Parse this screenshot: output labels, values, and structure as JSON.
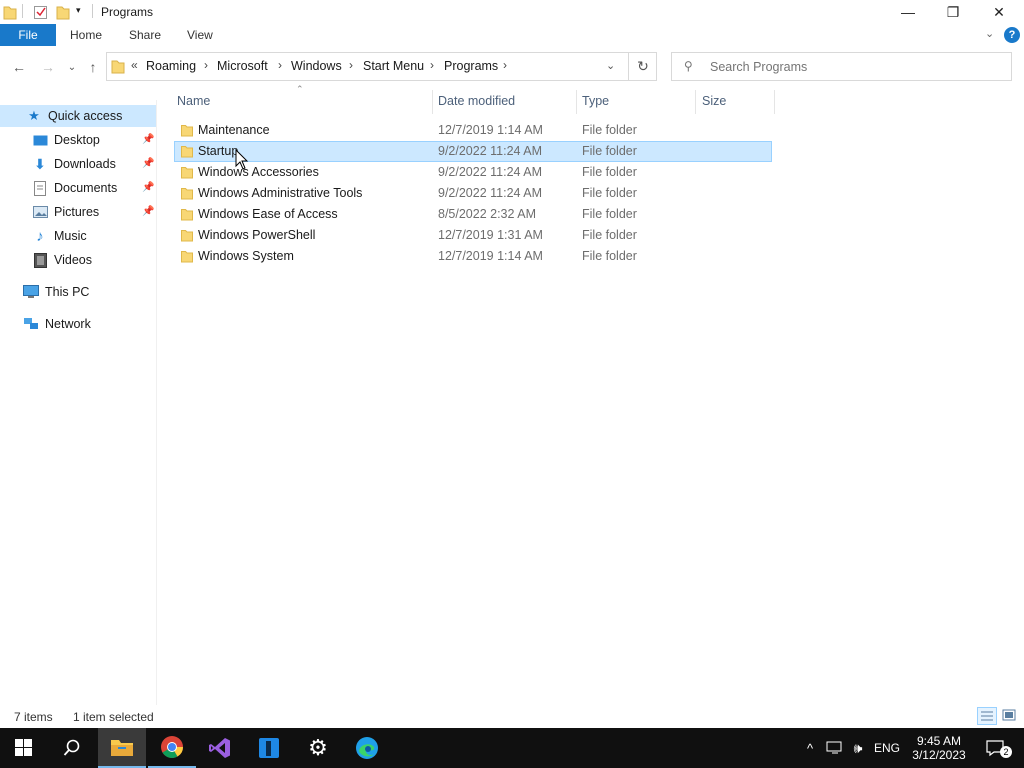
{
  "window": {
    "title": "Programs"
  },
  "ribbon": {
    "tabs": [
      "File",
      "Home",
      "Share",
      "View"
    ]
  },
  "address": {
    "overflow": "«",
    "crumbs": [
      "Roaming",
      "Microsoft",
      "Windows",
      "Start Menu",
      "Programs"
    ],
    "search_placeholder": "Search Programs"
  },
  "nav": {
    "quick_access": "Quick access",
    "items": [
      {
        "label": "Desktop",
        "icon": "desktop-icon",
        "pinned": true
      },
      {
        "label": "Downloads",
        "icon": "downloads-icon",
        "pinned": true
      },
      {
        "label": "Documents",
        "icon": "documents-icon",
        "pinned": true
      },
      {
        "label": "Pictures",
        "icon": "pictures-icon",
        "pinned": true
      },
      {
        "label": "Music",
        "icon": "music-icon",
        "pinned": false
      },
      {
        "label": "Videos",
        "icon": "videos-icon",
        "pinned": false
      }
    ],
    "this_pc": "This PC",
    "network": "Network"
  },
  "columns": {
    "name": "Name",
    "date": "Date modified",
    "type": "Type",
    "size": "Size"
  },
  "files": [
    {
      "name": "Maintenance",
      "date": "12/7/2019 1:14 AM",
      "type": "File folder",
      "selected": false
    },
    {
      "name": "Startup",
      "date": "9/2/2022 11:24 AM",
      "type": "File folder",
      "selected": true
    },
    {
      "name": "Windows Accessories",
      "date": "9/2/2022 11:24 AM",
      "type": "File folder",
      "selected": false
    },
    {
      "name": "Windows Administrative Tools",
      "date": "9/2/2022 11:24 AM",
      "type": "File folder",
      "selected": false
    },
    {
      "name": "Windows Ease of Access",
      "date": "8/5/2022 2:32 AM",
      "type": "File folder",
      "selected": false
    },
    {
      "name": "Windows PowerShell",
      "date": "12/7/2019 1:31 AM",
      "type": "File folder",
      "selected": false
    },
    {
      "name": "Windows System",
      "date": "12/7/2019 1:14 AM",
      "type": "File folder",
      "selected": false
    }
  ],
  "status": {
    "count": "7 items",
    "selection": "1 item selected"
  },
  "taskbar": {
    "apps": [
      "windows-start-icon",
      "search-icon",
      "file-explorer-icon",
      "chrome-icon",
      "visual-studio-icon",
      "app-icon",
      "settings-icon",
      "edge-icon"
    ],
    "language": "ENG",
    "time": "9:45 AM",
    "date": "3/12/2023",
    "notifications": "2"
  },
  "colors": {
    "accent": "#1979ca",
    "selection": "#cce8ff",
    "folder": "#f8d775",
    "taskbar": "#101010"
  }
}
